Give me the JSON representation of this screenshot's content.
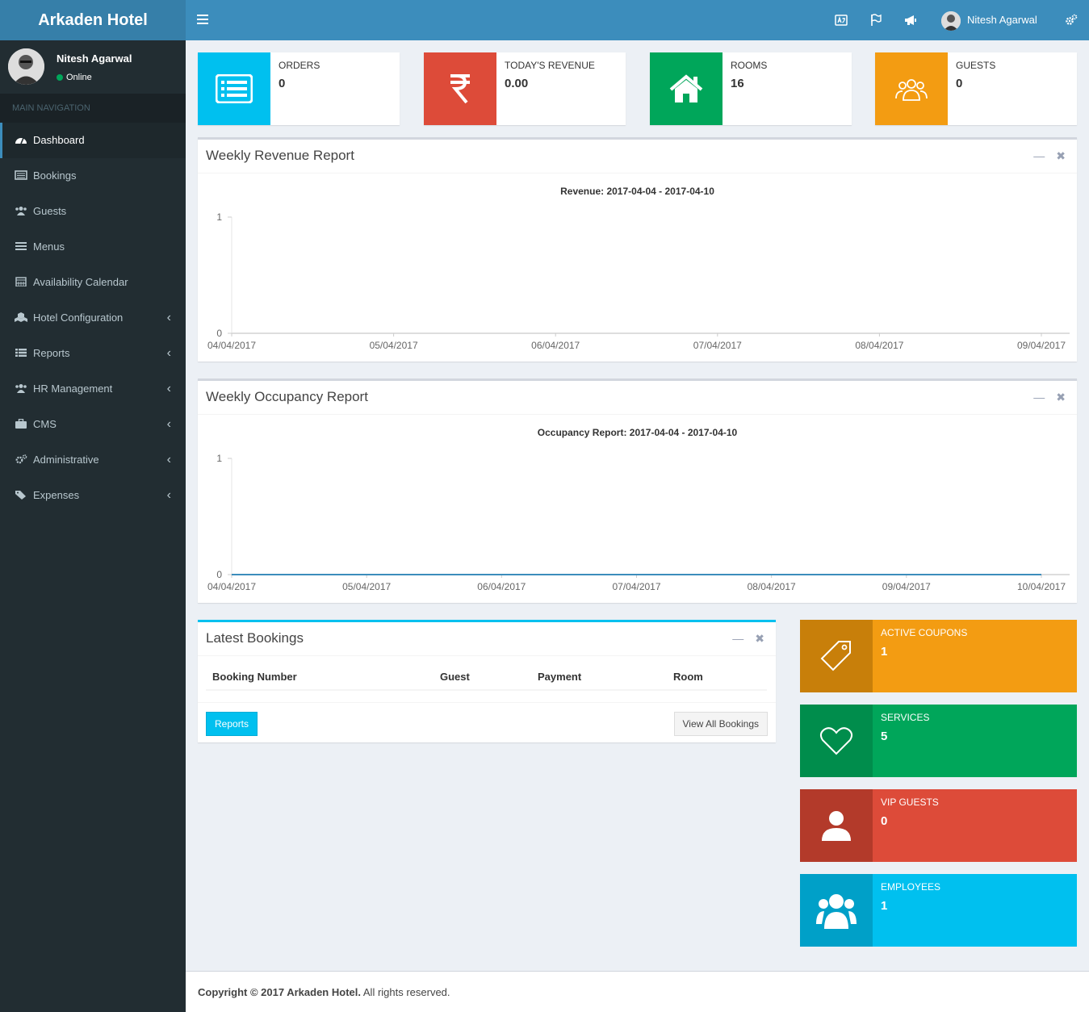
{
  "app": {
    "title": "Arkaden Hotel"
  },
  "user": {
    "name": "Nitesh Agarwal",
    "status": "Online"
  },
  "sidebar": {
    "header": "MAIN NAVIGATION",
    "items": [
      {
        "label": "Dashboard",
        "icon": "dashboard-icon",
        "active": true
      },
      {
        "label": "Bookings",
        "icon": "bookings-icon"
      },
      {
        "label": "Guests",
        "icon": "users-icon"
      },
      {
        "label": "Menus",
        "icon": "menu-icon"
      },
      {
        "label": "Availability Calendar",
        "icon": "calendar-icon"
      },
      {
        "label": "Hotel Configuration",
        "icon": "cubes-icon",
        "expandable": true
      },
      {
        "label": "Reports",
        "icon": "list-icon",
        "expandable": true
      },
      {
        "label": "HR Management",
        "icon": "users-icon",
        "expandable": true
      },
      {
        "label": "CMS",
        "icon": "briefcase-icon",
        "expandable": true
      },
      {
        "label": "Administrative",
        "icon": "gears-icon",
        "expandable": true
      },
      {
        "label": "Expenses",
        "icon": "tags-icon",
        "expandable": true
      }
    ]
  },
  "topbar": {
    "user_name": "Nitesh Agarwal"
  },
  "stats": [
    {
      "label": "ORDERS",
      "value": "0",
      "color": "#00c0ef",
      "icon": "list-alt-icon"
    },
    {
      "label": "TODAY'S REVENUE",
      "value": "0.00",
      "color": "#dd4b39",
      "icon": "rupee-icon"
    },
    {
      "label": "ROOMS",
      "value": "16",
      "color": "#00a65a",
      "icon": "home-icon"
    },
    {
      "label": "GUESTS",
      "value": "0",
      "color": "#f39c12",
      "icon": "guests-icon"
    }
  ],
  "revenue_box": {
    "title": "Weekly Revenue Report"
  },
  "occupancy_box": {
    "title": "Weekly Occupancy Report"
  },
  "chart_data": [
    {
      "type": "line",
      "title": "Revenue: 2017-04-04 - 2017-04-10",
      "x": [
        "04/04/2017",
        "05/04/2017",
        "06/04/2017",
        "07/04/2017",
        "08/04/2017",
        "09/04/2017"
      ],
      "ylim": [
        0,
        1
      ],
      "yticks": [
        "1",
        "0"
      ],
      "series": [
        {
          "values": []
        }
      ]
    },
    {
      "type": "line",
      "title": "Occupancy Report: 2017-04-04 - 2017-04-10",
      "x": [
        "04/04/2017",
        "05/04/2017",
        "06/04/2017",
        "07/04/2017",
        "08/04/2017",
        "09/04/2017",
        "10/04/2017"
      ],
      "ylim": [
        0,
        1
      ],
      "yticks": [
        "1",
        "0"
      ],
      "series": [
        {
          "values": [
            0,
            0,
            0,
            0,
            0,
            0,
            0
          ],
          "color": "#3c8dbc"
        }
      ]
    }
  ],
  "bookings": {
    "title": "Latest Bookings",
    "columns": [
      "Booking Number",
      "Guest",
      "Payment",
      "Room"
    ],
    "reports_button": "Reports",
    "view_all_button": "View All Bookings"
  },
  "side_stats": [
    {
      "label": "ACTIVE COUPONS",
      "value": "1",
      "color": "#f39c12",
      "dark": "#c87f0a",
      "icon": "tag-icon"
    },
    {
      "label": "SERVICES",
      "value": "5",
      "color": "#00a65a",
      "dark": "#008d4c",
      "icon": "heart-icon"
    },
    {
      "label": "VIP GUESTS",
      "value": "0",
      "color": "#dd4b39",
      "dark": "#b33a2a",
      "icon": "user-icon"
    },
    {
      "label": "EMPLOYEES",
      "value": "1",
      "color": "#00c0ef",
      "dark": "#00a0c8",
      "icon": "group-icon"
    }
  ],
  "footer": {
    "copyright": "Copyright © 2017 Arkaden Hotel.",
    "rights": " All rights reserved."
  }
}
